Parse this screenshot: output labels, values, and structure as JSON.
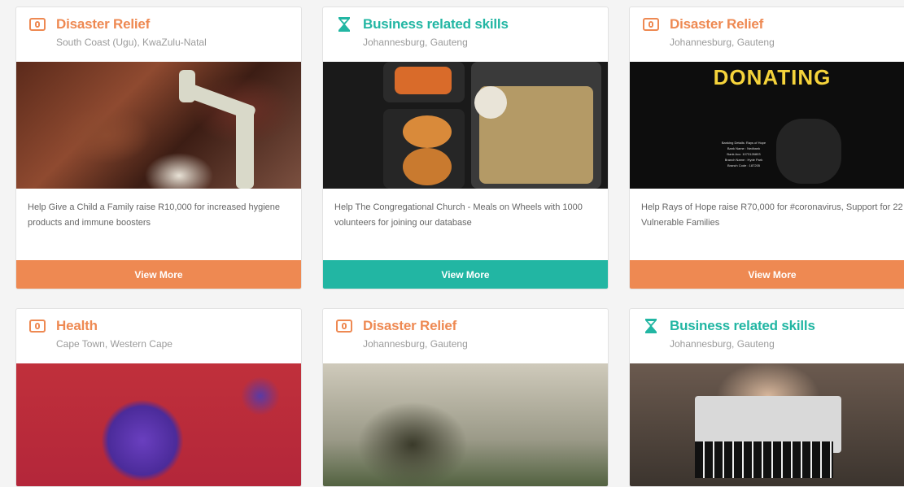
{
  "cards": [
    {
      "category": "Disaster Relief",
      "icon": "donation-box-icon",
      "accent": "#ee8952",
      "location": "South Coast (Ugu), KwaZulu-Natal",
      "image": "children washing hands under tap",
      "description": "Help Give a Child a Family raise R10,000 for increased hygiene products and immune boosters",
      "button": "View More"
    },
    {
      "category": "Business related skills",
      "icon": "hourglass-icon",
      "accent": "#22b6a3",
      "location": "Johannesburg, Gauteng",
      "image": "meal tray with food",
      "description": "Help The Congregational Church - Meals on Wheels with 1000 volunteers for joining our database",
      "button": "View More"
    },
    {
      "category": "Disaster Relief",
      "icon": "donation-box-icon",
      "accent": "#ee8952",
      "location": "Johannesburg, Gauteng",
      "image_text": "DONATING",
      "image_small_text": [
        "Banking Details: Rays of Hope",
        "Bank Name : Nedbank",
        "Bank Acc: 1073126803",
        "Branch Name : Hyde Park",
        "Branch Code : 187205"
      ],
      "description": "Help Rays of Hope raise R70,000 for #coronavirus, Support for 22 Vulnerable Families",
      "button": "View More"
    },
    {
      "category": "Health",
      "icon": "donation-box-icon",
      "accent": "#ee8952",
      "location": "Cape Town, Western Cape"
    },
    {
      "category": "Disaster Relief",
      "icon": "donation-box-icon",
      "accent": "#ee8952",
      "location": "Johannesburg, Gauteng"
    },
    {
      "category": "Business related skills",
      "icon": "hourglass-icon",
      "accent": "#22b6a3",
      "location": "Johannesburg, Gauteng"
    }
  ]
}
